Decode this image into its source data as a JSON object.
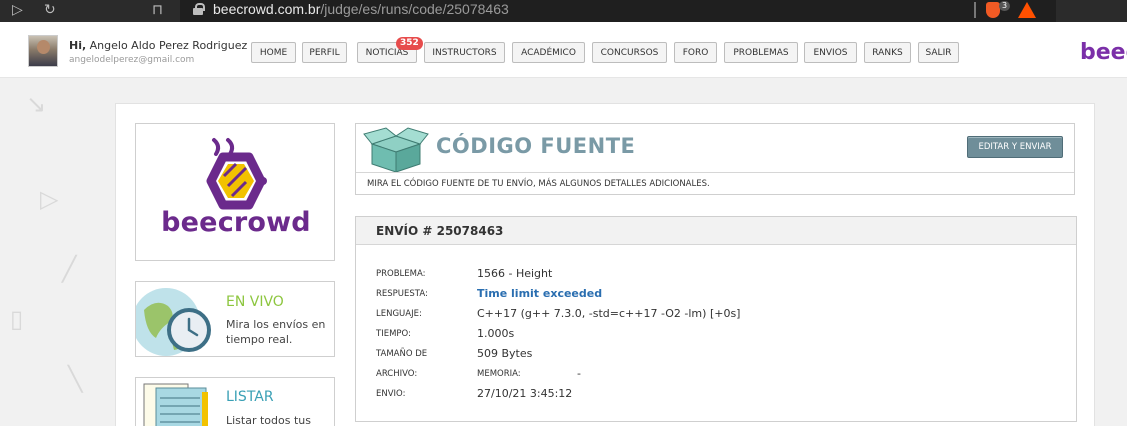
{
  "browser": {
    "url_domain": "beecrowd.com.br",
    "url_path": "/judge/es/runs/code/25078463",
    "brave_count": "3"
  },
  "header": {
    "greeting_prefix": "Hi,",
    "user_name": "Angelo Aldo Perez Rodriguez",
    "email": "angelodelperez@gmail.com",
    "brand": "beec",
    "notifications_count": "352",
    "nav": [
      {
        "label": "HOME"
      },
      {
        "label": "PERFIL"
      },
      {
        "label": "NOTICIAS"
      },
      {
        "label": "INSTRUCTORS"
      },
      {
        "label": "ACADÉMICO"
      },
      {
        "label": "CONCURSOS"
      },
      {
        "label": "FORO"
      },
      {
        "label": "PROBLEMAS"
      },
      {
        "label": "ENVIOS"
      },
      {
        "label": "RANKS"
      },
      {
        "label": "SALIR"
      }
    ]
  },
  "sidebar": {
    "logo_text": "beecrowd",
    "live": {
      "title": "EN VIVO",
      "text": "Mira los envíos en tiempo real."
    },
    "list": {
      "title": "LISTAR",
      "text": "Listar todos tus"
    }
  },
  "source": {
    "title": "CÓDIGO FUENTE",
    "edit_button": "EDITAR Y ENVIAR",
    "subtitle": "MIRA EL CÓDIGO FUENTE DE TU ENVÍO, MÁS ALGUNOS DETALLES ADICIONALES."
  },
  "run": {
    "heading": "ENVÍO # 25078463",
    "labels": {
      "problem": "PROBLEMA:",
      "answer": "RESPUESTA:",
      "language": "LENGUAJE:",
      "time": "TIEMPO:",
      "size": "TAMAÑO DE",
      "file": "ARCHIVO:",
      "submission": "ENVIO:",
      "memory": "MEMORIA:"
    },
    "values": {
      "problem": "1566 - Height",
      "answer": "Time limit exceeded",
      "language": "C++17 (g++ 7.3.0, -std=c++17 -O2 -lm) [+0s]",
      "time": "1.000s",
      "size": "509 Bytes",
      "memory": "-",
      "submission": "27/10/21 3:45:12"
    }
  },
  "colors": {
    "brand_purple": "#6b2a8c",
    "accent_gold": "#f2c200",
    "live_green": "#8dc63f",
    "list_teal": "#3aa0b5",
    "status_blue": "#2a6eb0",
    "badge_red": "#e74c4c",
    "button_slate": "#6f8e99"
  }
}
